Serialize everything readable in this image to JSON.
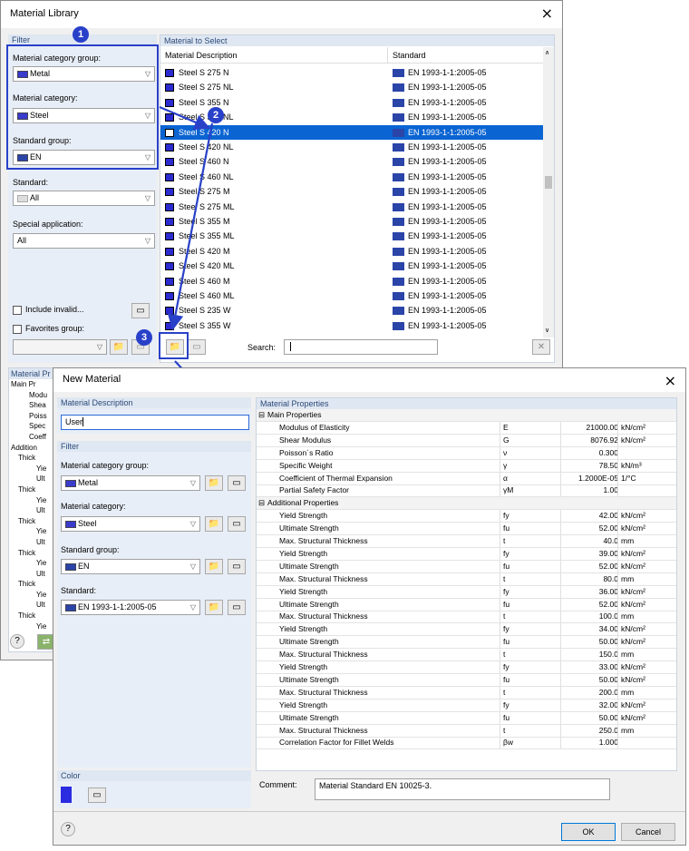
{
  "lib": {
    "title": "Material Library",
    "filter_header": "Filter",
    "select_header": "Material to Select",
    "col_desc": "Material Description",
    "col_std": "Standard",
    "cat_group_label": "Material category group:",
    "cat_group_value": "Metal",
    "cat_label": "Material category:",
    "cat_value": "Steel",
    "std_group_label": "Standard group:",
    "std_group_value": "EN",
    "std_label": "Standard:",
    "std_value": "All",
    "special_label": "Special application:",
    "special_value": "All",
    "include_invalid": "Include invalid...",
    "favorites": "Favorites group:",
    "search_label": "Search:",
    "search_value": "",
    "props_header": "Material Pr",
    "props_tree": [
      "Main Pr",
      "Modu",
      "Shea",
      "Poiss",
      "Spec",
      "Coeff",
      "Addition",
      "Thick",
      "Yie",
      "Ult",
      "Thick",
      "Yie",
      "Ult",
      "Thick",
      "Yie",
      "Ult",
      "Thick",
      "Yie",
      "Ult",
      "Thick",
      "Yie",
      "Ult",
      "Thick",
      "Yie"
    ],
    "materials": [
      {
        "name": "Steel S 275 N",
        "std": "EN 1993-1-1:2005-05"
      },
      {
        "name": "Steel S 275 NL",
        "std": "EN 1993-1-1:2005-05"
      },
      {
        "name": "Steel S 355 N",
        "std": "EN 1993-1-1:2005-05"
      },
      {
        "name": "Steel S 355 NL",
        "std": "EN 1993-1-1:2005-05"
      },
      {
        "name": "Steel S 420 N",
        "std": "EN 1993-1-1:2005-05"
      },
      {
        "name": "Steel S 420 NL",
        "std": "EN 1993-1-1:2005-05"
      },
      {
        "name": "Steel S 460 N",
        "std": "EN 1993-1-1:2005-05"
      },
      {
        "name": "Steel S 460 NL",
        "std": "EN 1993-1-1:2005-05"
      },
      {
        "name": "Steel S 275 M",
        "std": "EN 1993-1-1:2005-05"
      },
      {
        "name": "Steel S 275 ML",
        "std": "EN 1993-1-1:2005-05"
      },
      {
        "name": "Steel S 355 M",
        "std": "EN 1993-1-1:2005-05"
      },
      {
        "name": "Steel S 355 ML",
        "std": "EN 1993-1-1:2005-05"
      },
      {
        "name": "Steel S 420 M",
        "std": "EN 1993-1-1:2005-05"
      },
      {
        "name": "Steel S 420 ML",
        "std": "EN 1993-1-1:2005-05"
      },
      {
        "name": "Steel S 460 M",
        "std": "EN 1993-1-1:2005-05"
      },
      {
        "name": "Steel S 460 ML",
        "std": "EN 1993-1-1:2005-05"
      },
      {
        "name": "Steel S 235 W",
        "std": "EN 1993-1-1:2005-05"
      },
      {
        "name": "Steel S 355 W",
        "std": "EN 1993-1-1:2005-05"
      }
    ],
    "selected_index": 4
  },
  "callouts": [
    "1",
    "2",
    "3"
  ],
  "nm": {
    "title": "New Material",
    "desc_header": "Material Description",
    "desc_value": "User",
    "filter_header": "Filter",
    "cat_group_label": "Material category group:",
    "cat_group_value": "Metal",
    "cat_label": "Material category:",
    "cat_value": "Steel",
    "std_group_label": "Standard group:",
    "std_group_value": "EN",
    "std_label": "Standard:",
    "std_value": "EN 1993-1-1:2005-05",
    "color_header": "Color",
    "props_header": "Material Properties",
    "main_group": "Main Properties",
    "add_group": "Additional Properties",
    "main_props": [
      {
        "name": "Modulus of Elasticity",
        "sym": "E",
        "val": "21000.00",
        "unit": "kN/cm²"
      },
      {
        "name": "Shear Modulus",
        "sym": "G",
        "val": "8076.92",
        "unit": "kN/cm²"
      },
      {
        "name": "Poisson´s Ratio",
        "sym": "ν",
        "val": "0.300",
        "unit": ""
      },
      {
        "name": "Specific Weight",
        "sym": "γ",
        "val": "78.50",
        "unit": "kN/m³"
      },
      {
        "name": "Coefficient of Thermal Expansion",
        "sym": "α",
        "val": "1.2000E-05",
        "unit": "1/°C"
      },
      {
        "name": "Partial Safety Factor",
        "sym": "γM",
        "val": "1.00",
        "unit": ""
      }
    ],
    "add_props": [
      {
        "name": "Yield Strength",
        "sym": "fy",
        "val": "42.00",
        "unit": "kN/cm²"
      },
      {
        "name": "Ultimate Strength",
        "sym": "fu",
        "val": "52.00",
        "unit": "kN/cm²"
      },
      {
        "name": "Max. Structural Thickness",
        "sym": "t",
        "val": "40.0",
        "unit": "mm"
      },
      {
        "name": "Yield Strength",
        "sym": "fy",
        "val": "39.00",
        "unit": "kN/cm²"
      },
      {
        "name": "Ultimate Strength",
        "sym": "fu",
        "val": "52.00",
        "unit": "kN/cm²"
      },
      {
        "name": "Max. Structural Thickness",
        "sym": "t",
        "val": "80.0",
        "unit": "mm"
      },
      {
        "name": "Yield Strength",
        "sym": "fy",
        "val": "36.00",
        "unit": "kN/cm²"
      },
      {
        "name": "Ultimate Strength",
        "sym": "fu",
        "val": "52.00",
        "unit": "kN/cm²"
      },
      {
        "name": "Max. Structural Thickness",
        "sym": "t",
        "val": "100.0",
        "unit": "mm"
      },
      {
        "name": "Yield Strength",
        "sym": "fy",
        "val": "34.00",
        "unit": "kN/cm²"
      },
      {
        "name": "Ultimate Strength",
        "sym": "fu",
        "val": "50.00",
        "unit": "kN/cm²"
      },
      {
        "name": "Max. Structural Thickness",
        "sym": "t",
        "val": "150.0",
        "unit": "mm"
      },
      {
        "name": "Yield Strength",
        "sym": "fy",
        "val": "33.00",
        "unit": "kN/cm²"
      },
      {
        "name": "Ultimate Strength",
        "sym": "fu",
        "val": "50.00",
        "unit": "kN/cm²"
      },
      {
        "name": "Max. Structural Thickness",
        "sym": "t",
        "val": "200.0",
        "unit": "mm"
      },
      {
        "name": "Yield Strength",
        "sym": "fy",
        "val": "32.00",
        "unit": "kN/cm²"
      },
      {
        "name": "Ultimate Strength",
        "sym": "fu",
        "val": "50.00",
        "unit": "kN/cm²"
      },
      {
        "name": "Max. Structural Thickness",
        "sym": "t",
        "val": "250.0",
        "unit": "mm"
      },
      {
        "name": "Correlation Factor for Fillet Welds",
        "sym": "βw",
        "val": "1.000",
        "unit": ""
      }
    ],
    "comment_label": "Comment:",
    "comment_value": "Material Standard EN 10025-3.",
    "ok": "OK",
    "cancel": "Cancel"
  },
  "colors": {
    "accent": "#2941c9",
    "swatch": "#3a3acc",
    "selection": "#0a64d2",
    "header": "#dfe7f2"
  }
}
